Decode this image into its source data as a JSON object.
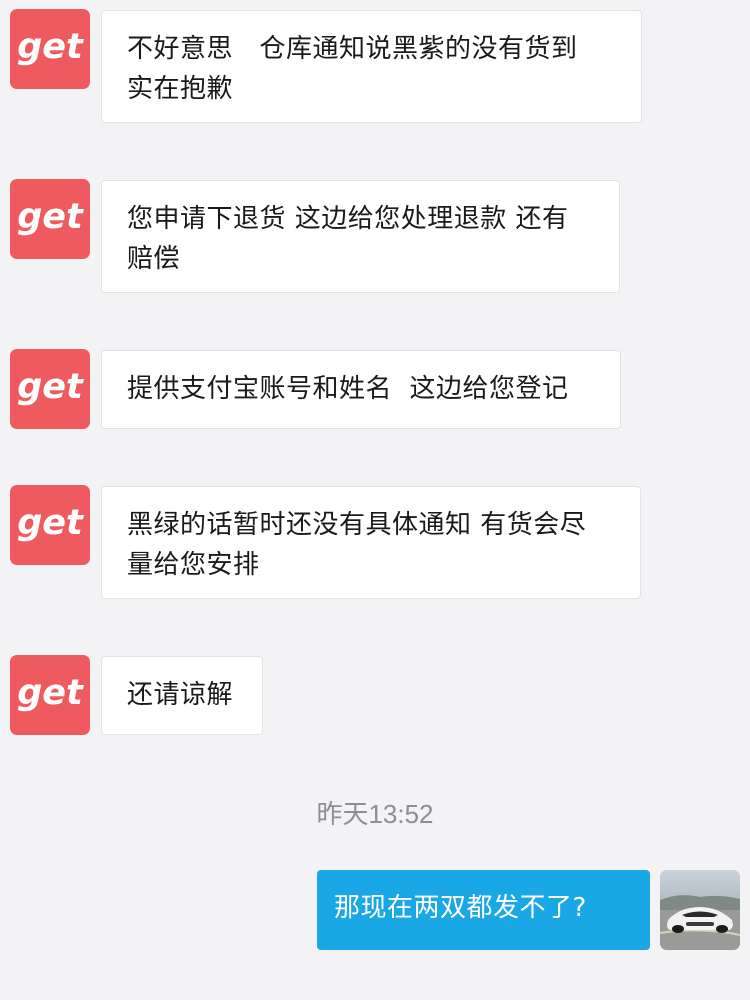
{
  "agent": {
    "avatar_text": "get",
    "avatar_color": "#ef5a5f"
  },
  "messages": [
    {
      "text": "不好意思　仓库通知说黑紫的没有货到\n实在抱歉"
    },
    {
      "text": "您申请下退货 这边给您处理退款 还有\n赔偿"
    },
    {
      "text": "提供支付宝账号和姓名  这边给您登记"
    },
    {
      "text": "黑绿的话暂时还没有具体通知 有货会尽\n量给您安排"
    },
    {
      "text": "还请谅解"
    }
  ],
  "timestamp": "昨天13:52",
  "user_message": {
    "text": "那现在两双都发不了?",
    "bubble_color": "#1aa7e6"
  },
  "user_avatar": {
    "icon": "sports-car-photo-avatar"
  }
}
